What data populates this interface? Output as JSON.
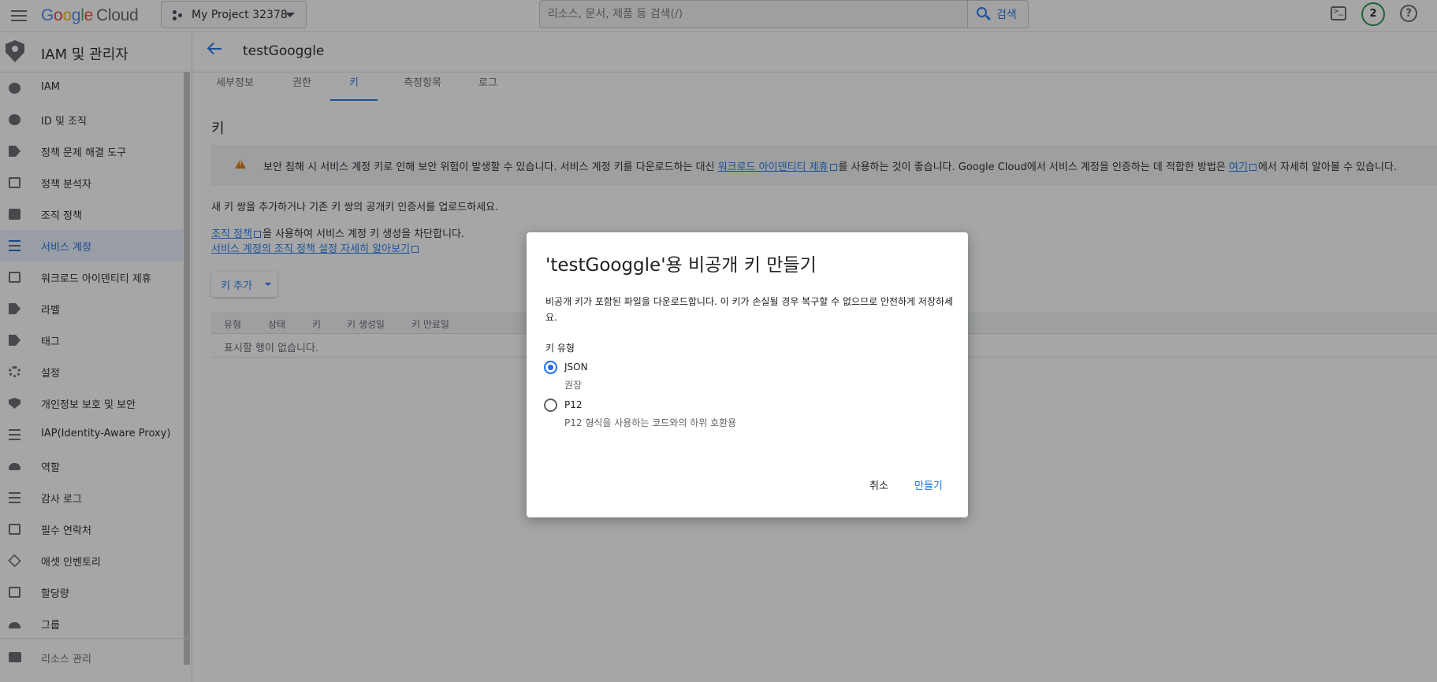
{
  "topbar": {
    "logo": "Google Cloud",
    "project": "My Project 32378",
    "search_placeholder": "리소스, 문서, 제품 등 검색(/)",
    "search_button": "검색",
    "notification_count": "2",
    "help": "?"
  },
  "sidebar": {
    "title": "IAM 및 관리자",
    "items": [
      {
        "label": "IAM",
        "icon": "person-add-icon"
      },
      {
        "label": "ID 및 조직",
        "icon": "account-circle-icon"
      },
      {
        "label": "정책 문제 해결 도구",
        "icon": "wrench-icon"
      },
      {
        "label": "정책 분석자",
        "icon": "document-search-icon"
      },
      {
        "label": "조직 정책",
        "icon": "article-icon"
      },
      {
        "label": "서비스 계정",
        "icon": "service-account-icon"
      },
      {
        "label": "워크로드 아이덴티티 제휴",
        "icon": "id-card-icon"
      },
      {
        "label": "라벨",
        "icon": "label-icon"
      },
      {
        "label": "태그",
        "icon": "tag-icon"
      },
      {
        "label": "설정",
        "icon": "gear-icon"
      },
      {
        "label": "개인정보 보호 및 보안",
        "icon": "shield-icon"
      },
      {
        "label": "IAP(Identity-Aware Proxy)",
        "icon": "proxy-icon"
      },
      {
        "label": "역할",
        "icon": "hat-icon"
      },
      {
        "label": "감사 로그",
        "icon": "list-icon"
      },
      {
        "label": "필수 연락처",
        "icon": "contact-icon"
      },
      {
        "label": "애셋 인벤토리",
        "icon": "diamond-icon"
      },
      {
        "label": "할당량",
        "icon": "quota-icon"
      },
      {
        "label": "그룹",
        "icon": "group-icon"
      }
    ],
    "active_index": 5,
    "footer": "리소스 관리"
  },
  "main": {
    "title": "testGooggle",
    "tabs": [
      "세부정보",
      "권한",
      "키",
      "측정항목",
      "로그"
    ],
    "active_tab": 2,
    "section_title": "키",
    "warning": {
      "text_before": "보안 침해 시 서비스 계정 키로 인해 보안 위험이 발생할 수 있습니다. 서비스 계정 키를 다운로드하는 대신 ",
      "link1": "워크로드 아이덴티티 제휴",
      "text_middle": "를 사용하는 것이 좋습니다. Google Cloud에서 서비스 계정을 인증하는 데 적합한 방법은 ",
      "link2": "여기",
      "text_after": "에서 자세히 알아볼 수 있습니다."
    },
    "intro": "새 키 쌍을 추가하거나 기존 키 쌍의 공개키 인증서를 업로드하세요.",
    "org_policy_link": "조직 정책",
    "org_policy_text": "을 사용하여 서비스 계정 키 생성을 차단합니다.",
    "learn_more_link": "서비스 계정의 조직 정책 설정 자세히 알아보기",
    "add_key_button": "키 추가",
    "table_headers": [
      "유형",
      "상태",
      "키",
      "키 생성일",
      "키 만료일"
    ],
    "empty_text": "표시할 행이 없습니다."
  },
  "dialog": {
    "title": "'testGooggle'용 비공개 키 만들기",
    "description": "비공개 키가 포함된 파일을 다운로드합니다. 이 키가 손실될 경우 복구할 수 없으므로 안전하게 저장하세요.",
    "key_type_label": "키 유형",
    "options": [
      {
        "label": "JSON",
        "sub": "권장",
        "checked": true
      },
      {
        "label": "P12",
        "sub": "P12 형식을 사용하는 코드와의 하위 호환용",
        "checked": false
      }
    ],
    "cancel": "취소",
    "create": "만들기"
  }
}
